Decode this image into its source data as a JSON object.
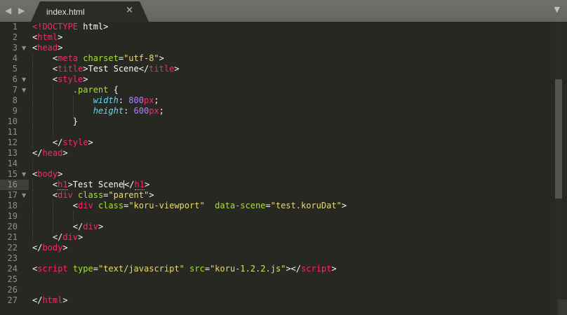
{
  "window": {
    "title": "index.html"
  },
  "tab_bar": {
    "nav_left": "◀",
    "nav_right": "▶",
    "tab_title": "index.html",
    "close_label": "×",
    "overflow_label": "▼"
  },
  "colors": {
    "editor_bg": "#272822",
    "tabbar_bg": "#6b6b66",
    "tag_pink": "#f92672",
    "attr_green": "#a6e22e",
    "string_yellow": "#e6db74",
    "property_cyan": "#66d9ef",
    "number_purple": "#ae81ff",
    "line_number_gray": "#8f908a"
  },
  "editor": {
    "current_line": 16,
    "lines": [
      {
        "n": 1,
        "fold": false,
        "current": false,
        "guides": [],
        "tokens": [
          [
            "tag",
            "<!DOCTYPE"
          ],
          [
            "p",
            " html>"
          ]
        ]
      },
      {
        "n": 2,
        "fold": false,
        "current": false,
        "guides": [],
        "tokens": [
          [
            "p",
            "<"
          ],
          [
            "tag",
            "html"
          ],
          [
            "p",
            ">"
          ]
        ]
      },
      {
        "n": 3,
        "fold": true,
        "current": false,
        "guides": [],
        "tokens": [
          [
            "p",
            "<"
          ],
          [
            "tag",
            "head"
          ],
          [
            "p",
            ">"
          ]
        ]
      },
      {
        "n": 4,
        "fold": false,
        "current": false,
        "guides": [
          0
        ],
        "tokens": [
          [
            "p",
            "    <"
          ],
          [
            "tag",
            "meta"
          ],
          [
            "p",
            " "
          ],
          [
            "attr",
            "charset"
          ],
          [
            "p",
            "="
          ],
          [
            "str",
            "\"utf-8\""
          ],
          [
            "p",
            ">"
          ]
        ]
      },
      {
        "n": 5,
        "fold": false,
        "current": false,
        "guides": [
          0
        ],
        "tokens": [
          [
            "p",
            "    <"
          ],
          [
            "tag",
            "title"
          ],
          [
            "p",
            ">Test Scene</"
          ],
          [
            "tag",
            "title"
          ],
          [
            "p",
            ">"
          ]
        ]
      },
      {
        "n": 6,
        "fold": true,
        "current": false,
        "guides": [
          0
        ],
        "tokens": [
          [
            "p",
            "    <"
          ],
          [
            "tag",
            "style"
          ],
          [
            "p",
            ">"
          ]
        ]
      },
      {
        "n": 7,
        "fold": true,
        "current": false,
        "guides": [
          0,
          4
        ],
        "tokens": [
          [
            "p",
            "        "
          ],
          [
            "sel",
            ".parent"
          ],
          [
            "p",
            " {"
          ]
        ]
      },
      {
        "n": 8,
        "fold": false,
        "current": false,
        "guides": [
          0,
          4,
          8
        ],
        "tokens": [
          [
            "p",
            "            "
          ],
          [
            "prop",
            "width"
          ],
          [
            "p",
            ": "
          ],
          [
            "num",
            "800"
          ],
          [
            "unit",
            "px"
          ],
          [
            "p",
            ";"
          ]
        ]
      },
      {
        "n": 9,
        "fold": false,
        "current": false,
        "guides": [
          0,
          4,
          8
        ],
        "tokens": [
          [
            "p",
            "            "
          ],
          [
            "prop",
            "height"
          ],
          [
            "p",
            ": "
          ],
          [
            "num",
            "600"
          ],
          [
            "unit",
            "px"
          ],
          [
            "p",
            ";"
          ]
        ]
      },
      {
        "n": 10,
        "fold": false,
        "current": false,
        "guides": [
          0,
          4
        ],
        "tokens": [
          [
            "p",
            "        }"
          ]
        ]
      },
      {
        "n": 11,
        "fold": false,
        "current": false,
        "guides": [
          0,
          4
        ],
        "tokens": []
      },
      {
        "n": 12,
        "fold": false,
        "current": false,
        "guides": [
          0
        ],
        "tokens": [
          [
            "p",
            "    </"
          ],
          [
            "tag",
            "style"
          ],
          [
            "p",
            ">"
          ]
        ]
      },
      {
        "n": 13,
        "fold": false,
        "current": false,
        "guides": [],
        "tokens": [
          [
            "p",
            "</"
          ],
          [
            "tag",
            "head"
          ],
          [
            "p",
            ">"
          ]
        ]
      },
      {
        "n": 14,
        "fold": false,
        "current": false,
        "guides": [
          0
        ],
        "tokens": []
      },
      {
        "n": 15,
        "fold": true,
        "current": false,
        "guides": [],
        "tokens": [
          [
            "p",
            "<"
          ],
          [
            "tag",
            "body"
          ],
          [
            "p",
            ">"
          ]
        ]
      },
      {
        "n": 16,
        "fold": false,
        "current": true,
        "guides": [
          0
        ],
        "tokens": [
          [
            "p",
            "    <"
          ],
          [
            "tagu",
            "h1"
          ],
          [
            "p",
            ">Test Scene"
          ],
          [
            "caret",
            ""
          ],
          [
            "p",
            "</"
          ],
          [
            "tagu",
            "h1"
          ],
          [
            "p",
            ">"
          ]
        ]
      },
      {
        "n": 17,
        "fold": true,
        "current": false,
        "guides": [
          0
        ],
        "tokens": [
          [
            "p",
            "    <"
          ],
          [
            "tag",
            "div"
          ],
          [
            "p",
            " "
          ],
          [
            "attr",
            "class"
          ],
          [
            "p",
            "="
          ],
          [
            "str",
            "\"parent\""
          ],
          [
            "p",
            ">"
          ]
        ]
      },
      {
        "n": 18,
        "fold": false,
        "current": false,
        "guides": [
          0,
          4
        ],
        "tokens": [
          [
            "p",
            "        <"
          ],
          [
            "tag",
            "div"
          ],
          [
            "p",
            " "
          ],
          [
            "attr",
            "class"
          ],
          [
            "p",
            "="
          ],
          [
            "str",
            "\"koru-viewport\""
          ],
          [
            "p",
            "  "
          ],
          [
            "attr",
            "data-scene"
          ],
          [
            "p",
            "="
          ],
          [
            "str",
            "\"test.koruDat\""
          ],
          [
            "p",
            ">"
          ]
        ]
      },
      {
        "n": 19,
        "fold": false,
        "current": false,
        "guides": [
          0,
          4,
          8
        ],
        "tokens": []
      },
      {
        "n": 20,
        "fold": false,
        "current": false,
        "guides": [
          0,
          4
        ],
        "tokens": [
          [
            "p",
            "        </"
          ],
          [
            "tag",
            "div"
          ],
          [
            "p",
            ">"
          ]
        ]
      },
      {
        "n": 21,
        "fold": false,
        "current": false,
        "guides": [
          0
        ],
        "tokens": [
          [
            "p",
            "    </"
          ],
          [
            "tag",
            "div"
          ],
          [
            "p",
            ">"
          ]
        ]
      },
      {
        "n": 22,
        "fold": false,
        "current": false,
        "guides": [],
        "tokens": [
          [
            "p",
            "</"
          ],
          [
            "tag",
            "body"
          ],
          [
            "p",
            ">"
          ]
        ]
      },
      {
        "n": 23,
        "fold": false,
        "current": false,
        "guides": [],
        "tokens": []
      },
      {
        "n": 24,
        "fold": false,
        "current": false,
        "guides": [],
        "tokens": [
          [
            "p",
            "<"
          ],
          [
            "tag",
            "script"
          ],
          [
            "p",
            " "
          ],
          [
            "attr",
            "type"
          ],
          [
            "p",
            "="
          ],
          [
            "str",
            "\"text/javascript\""
          ],
          [
            "p",
            " "
          ],
          [
            "attr",
            "src"
          ],
          [
            "p",
            "="
          ],
          [
            "str",
            "\"koru-1.2.2.js\""
          ],
          [
            "p",
            "></"
          ],
          [
            "tag",
            "script"
          ],
          [
            "p",
            ">"
          ]
        ]
      },
      {
        "n": 25,
        "fold": false,
        "current": false,
        "guides": [],
        "tokens": []
      },
      {
        "n": 26,
        "fold": false,
        "current": false,
        "guides": [],
        "tokens": []
      },
      {
        "n": 27,
        "fold": false,
        "current": false,
        "guides": [],
        "tokens": [
          [
            "p",
            "</"
          ],
          [
            "tag",
            "html"
          ],
          [
            "p",
            ">"
          ]
        ]
      }
    ]
  }
}
